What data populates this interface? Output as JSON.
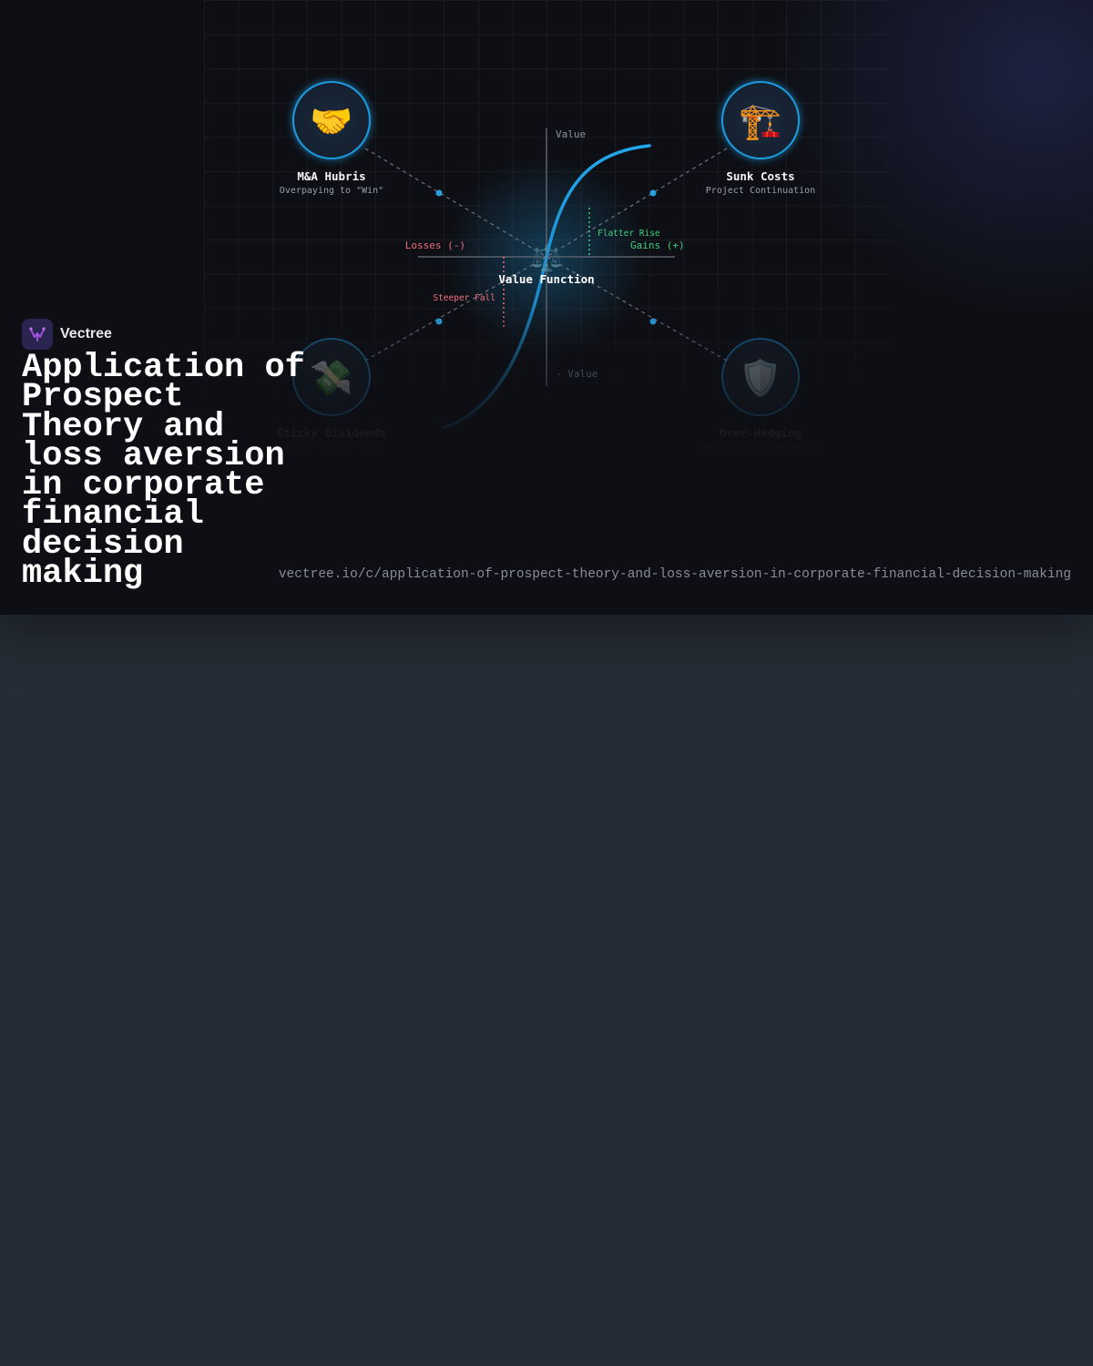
{
  "brand": {
    "name": "Vectree",
    "logo_icon": "vectree-logo-icon",
    "logo_color": "#a050e0"
  },
  "title": "Application of Prospect\nTheory and\nloss aversion\nin corporate\nfinancial\ndecision\nmaking",
  "url": "vectree.io/c/application-of-prospect-theory-and-loss-aversion-in-corporate-financial-decision-making",
  "diagram": {
    "center": {
      "label": "Value Function",
      "icon": "scales-icon",
      "glyph": "⚖️"
    },
    "axes": {
      "y_top": "Value",
      "y_bottom": "- Value",
      "x_left": "Losses (-)",
      "x_right": "Gains (+)"
    },
    "annotations": {
      "gain": "Flatter Rise",
      "loss": "Steeper Fall"
    },
    "nodes": [
      {
        "id": "ma-hubris",
        "title": "M&A Hubris",
        "subtitle": "Overpaying to \"Win\"",
        "icon": "handshake-icon",
        "glyph": "🤝"
      },
      {
        "id": "sunk-costs",
        "title": "Sunk Costs",
        "subtitle": "Project Continuation",
        "icon": "crane-icon",
        "glyph": "🏗️"
      },
      {
        "id": "sticky-dividends",
        "title": "Sticky Dividends",
        "subtitle": "Fear of Market Cuts",
        "icon": "money-with-wings-icon",
        "glyph": "💸"
      },
      {
        "id": "over-hedging",
        "title": "Over-Hedging",
        "subtitle": "Managerial Protection",
        "icon": "shield-icon",
        "glyph": "🛡️"
      }
    ]
  },
  "colors": {
    "accent": "#1e9be0",
    "gain": "#3ecf80",
    "loss": "#f07080",
    "background": "#0e0f14",
    "page": "#252c35"
  }
}
